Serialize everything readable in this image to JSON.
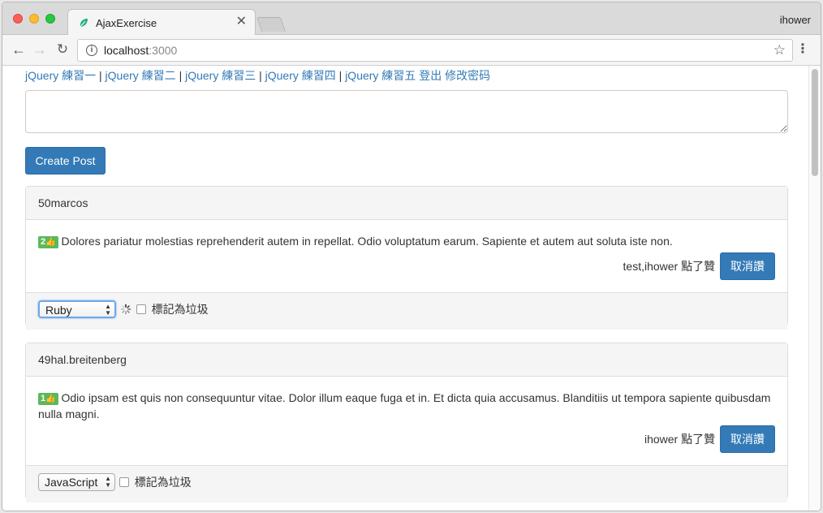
{
  "browser": {
    "tab_title": "AjaxExercise",
    "tab_close_glyph": "✕",
    "profile_name": "ihower",
    "url_host": "localhost",
    "url_port": ":3000",
    "icons": {
      "back": "back-arrow-icon",
      "forward": "forward-arrow-icon",
      "reload": "reload-icon",
      "info": "info-icon",
      "star": "star-icon",
      "menu": "menu-dots-icon",
      "favicon": "leaf-favicon-icon"
    },
    "glyphs": {
      "back": "←",
      "forward": "→",
      "reload": "↻",
      "info": "i",
      "star": "☆",
      "menu": "⋮"
    }
  },
  "nav": {
    "links": [
      "jQuery 練習一",
      "jQuery 練習二",
      "jQuery 練習三",
      "jQuery 練習四",
      "jQuery 練習五"
    ],
    "separator": "|",
    "logout": "登出",
    "change_password": "修改密码"
  },
  "composer": {
    "value": "",
    "create_button": "Create Post"
  },
  "posts": [
    {
      "author": "50marcos",
      "like_count": "2",
      "like_icon": "👍",
      "body": "Dolores pariatur molestias reprehenderit autem in repellat. Odio voluptatum earum. Sapiente et autem aut soluta iste non.",
      "liked_by": "test,ihower 點了贊",
      "unlike_button": "取消讚",
      "category": "Ruby",
      "category_focused": true,
      "show_spinner": true,
      "spam_label": "標記為垃圾"
    },
    {
      "author": "49hal.breitenberg",
      "like_count": "1",
      "like_icon": "👍",
      "body": "Odio ipsam est quis non consequuntur vitae. Dolor illum eaque fuga et in. Et dicta quia accusamus. Blanditiis ut tempora sapiente quibusdam nulla magni.",
      "liked_by": "ihower 點了贊",
      "unlike_button": "取消讚",
      "category": "JavaScript",
      "category_focused": false,
      "show_spinner": false,
      "spam_label": "標記為垃圾"
    }
  ],
  "colors": {
    "link": "#337ab7",
    "primary": "#337ab7",
    "badge": "#5cb85c",
    "panel_bg": "#f5f5f5"
  }
}
